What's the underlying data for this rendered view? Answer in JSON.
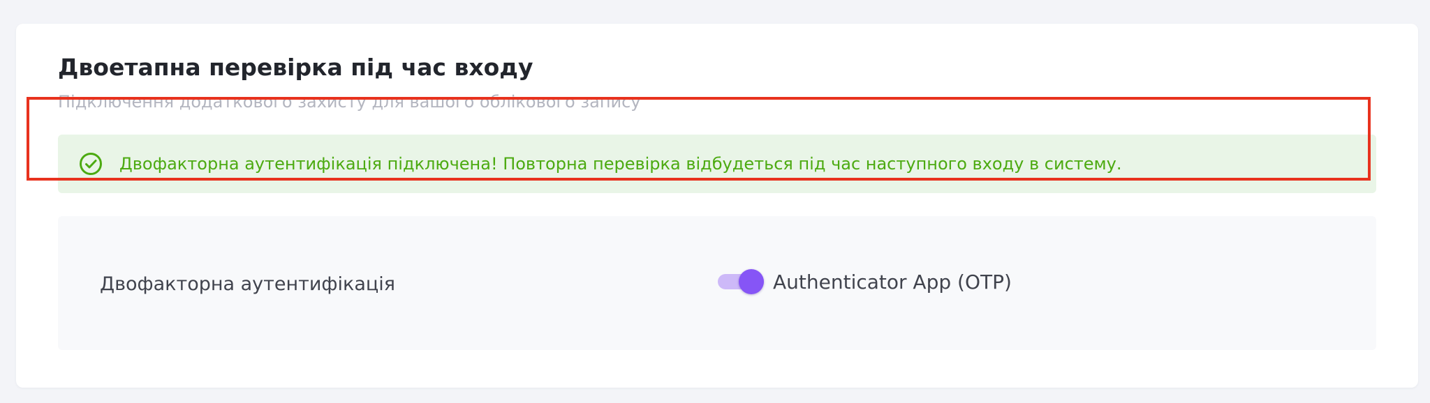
{
  "section": {
    "title": "Двоетапна перевірка під час входу",
    "subtitle": "Підключення додаткового захисту для вашого облікового запису"
  },
  "alert": {
    "icon": "check-circle-icon",
    "message": "Двофакторна аутентифікація підключена! Повторна перевірка відбудеться під час наступного входу в систему.",
    "color": "#4caa11",
    "background": "#e9f5e7"
  },
  "settings": {
    "label": "Двофакторна аутентифікація",
    "toggle": {
      "enabled": true,
      "label": "Authenticator App (OTP)",
      "accent": "#8655f6"
    }
  },
  "highlight": {
    "color": "#e8321e"
  }
}
